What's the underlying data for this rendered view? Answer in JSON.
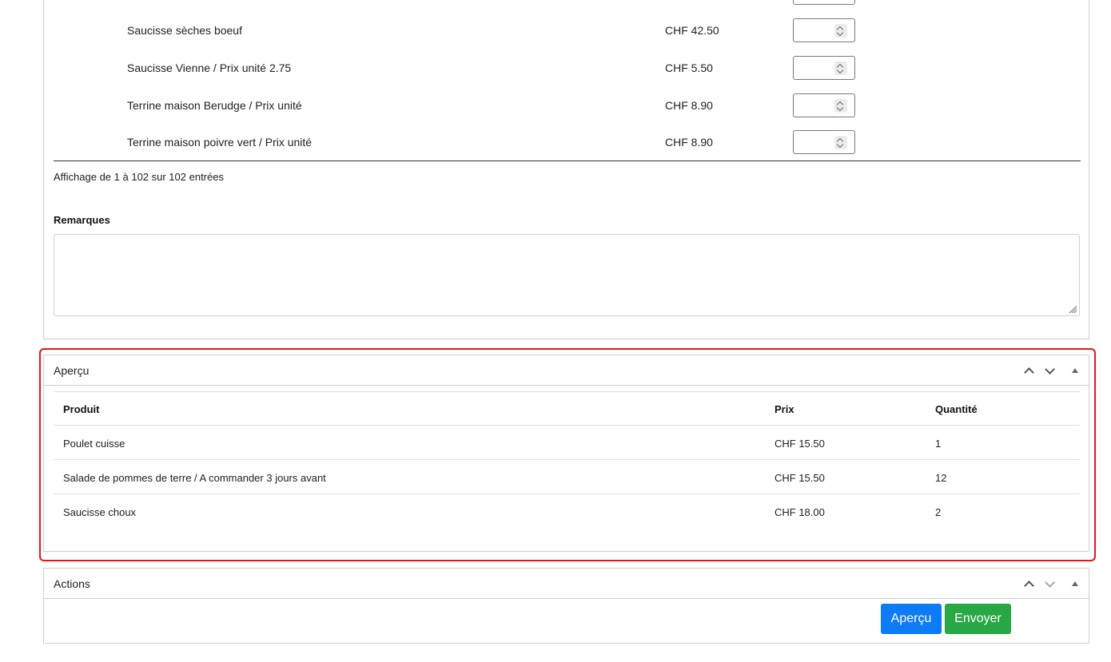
{
  "products": [
    {
      "name": "Saucisse sèches boeuf",
      "price": "CHF 42.50"
    },
    {
      "name": "Saucisse Vienne / Prix unité 2.75",
      "price": "CHF 5.50"
    },
    {
      "name": "Terrine maison Berudge / Prix unité",
      "price": "CHF 8.90"
    },
    {
      "name": "Terrine maison poivre vert / Prix unité",
      "price": "CHF 8.90"
    }
  ],
  "table_info": "Affichage de 1 à 102 sur 102 entrées",
  "remarks": {
    "label": "Remarques",
    "value": ""
  },
  "preview": {
    "title": "Aperçu",
    "headers": {
      "product": "Produit",
      "price": "Prix",
      "quantity": "Quantité"
    },
    "rows": [
      {
        "product": "Poulet cuisse",
        "price": "CHF 15.50",
        "quantity": "1"
      },
      {
        "product": "Salade de pommes de terre / A commander 3 jours avant",
        "price": "CHF 15.50",
        "quantity": "12"
      },
      {
        "product": "Saucisse choux",
        "price": "CHF 18.00",
        "quantity": "2"
      }
    ]
  },
  "actions": {
    "title": "Actions",
    "preview_button": "Aperçu",
    "send_button": "Envoyer"
  },
  "colors": {
    "highlight": "#e8141c",
    "primary": "#0d7bf5",
    "success": "#28a745"
  }
}
